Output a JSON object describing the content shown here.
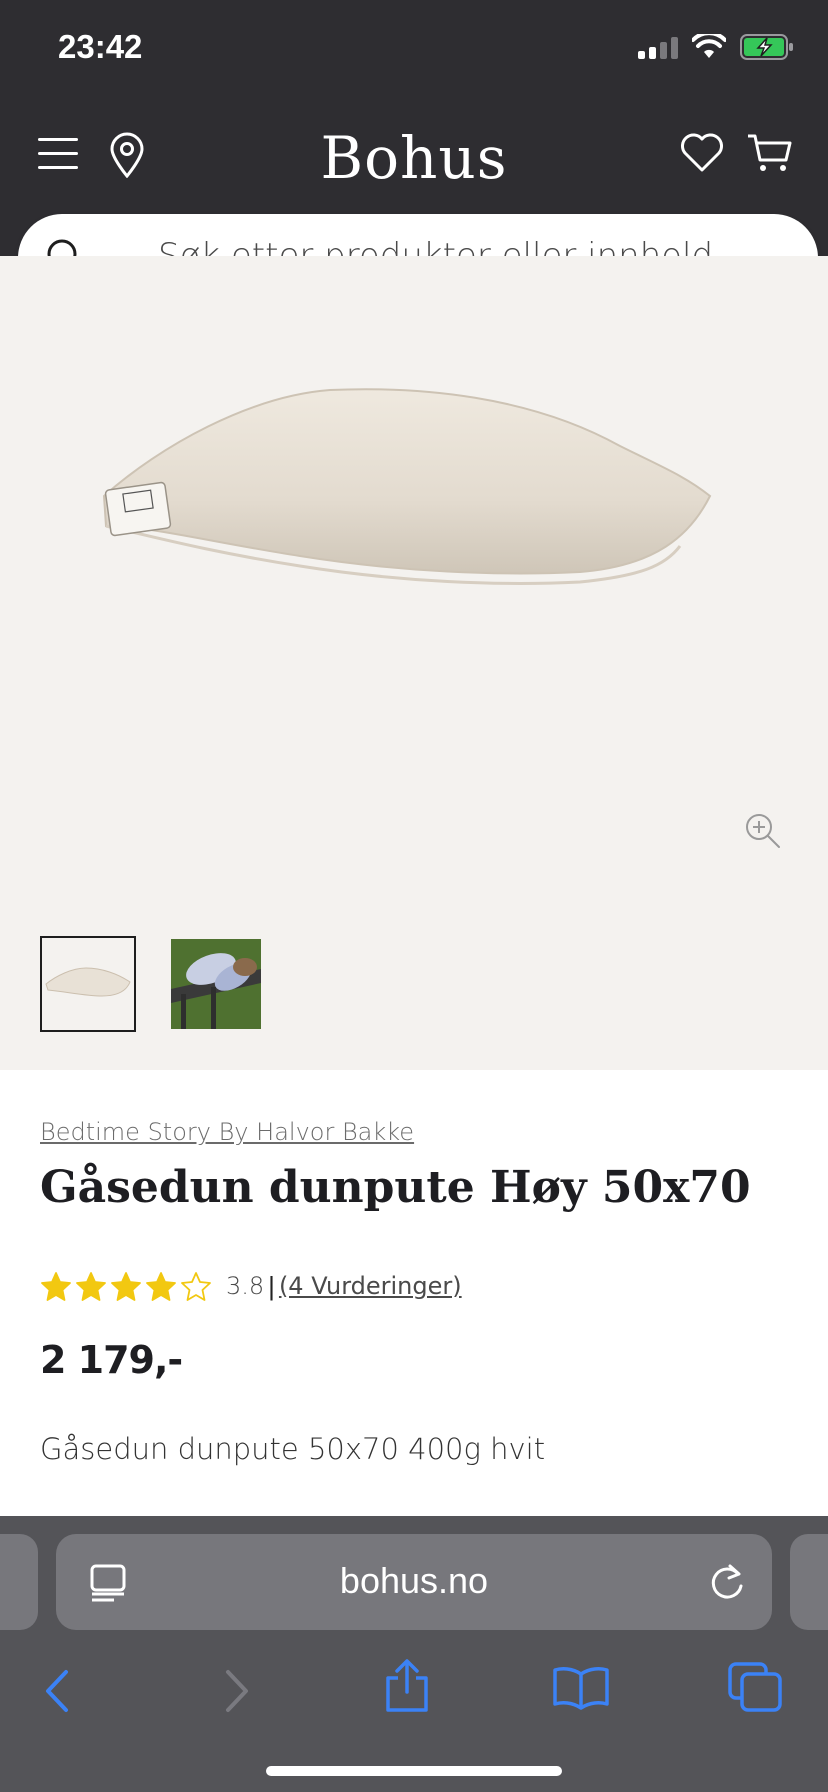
{
  "status_bar": {
    "time": "23:42"
  },
  "header": {
    "brand": "Bohus"
  },
  "search": {
    "placeholder": "Søk etter produkter eller innhold..."
  },
  "product": {
    "brand_link": "Bedtime Story By Halvor Bakke",
    "title": "Gåsedun dunpute Høy 50x70",
    "rating_value": "3.8",
    "rating_separator": "|",
    "reviews_link": "(4 Vurderinger)",
    "rating_stars": 3.8,
    "price": "2 179,-",
    "description": "Gåsedun dunpute 50x70 400g hvit"
  },
  "browser": {
    "url": "bohus.no"
  },
  "colors": {
    "header_bg": "#2e2d31",
    "star": "#f2c811",
    "ios_blue": "#3b82f6",
    "battery_green": "#35c759"
  },
  "icons": [
    "menu-icon",
    "location-pin-icon",
    "heart-icon",
    "cart-icon",
    "search-icon",
    "zoom-in-icon",
    "reader-icon",
    "reload-icon",
    "back-icon",
    "forward-icon",
    "share-icon",
    "bookmarks-icon",
    "tabs-icon"
  ]
}
